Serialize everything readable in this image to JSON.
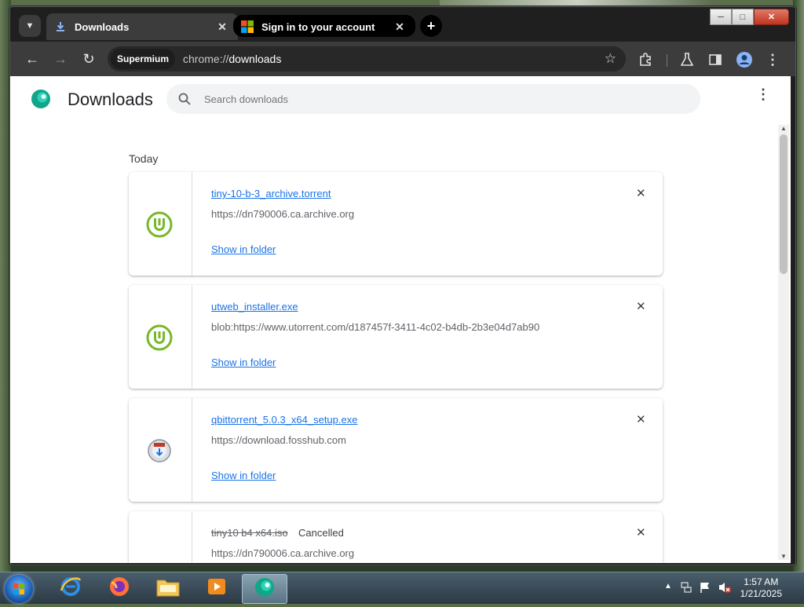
{
  "browser": {
    "tabs": [
      {
        "title": "Downloads",
        "active": true,
        "icon": "download-icon"
      },
      {
        "title": "Sign in to your account",
        "active": false,
        "icon": "microsoft-icon"
      }
    ],
    "new_tab_label": "+",
    "close_glyph": "✕",
    "profile_chip": "Supermium",
    "url_scheme": "chrome://",
    "url_host": "downloads"
  },
  "page": {
    "title": "Downloads",
    "search_placeholder": "Search downloads",
    "section_label": "Today",
    "show_in_folder": "Show in folder",
    "downloads": [
      {
        "name": "tiny-10-b-3_archive.torrent",
        "source": "https://dn790006.ca.archive.org",
        "status": "",
        "icon": "utorrent-icon"
      },
      {
        "name": "utweb_installer.exe",
        "source": "blob:https://www.utorrent.com/d187457f-3411-4c02-b4db-2b3e04d7ab90",
        "status": "",
        "icon": "utorrent-icon"
      },
      {
        "name": "qbittorrent_5.0.3_x64_setup.exe",
        "source": "https://download.fosshub.com",
        "status": "",
        "icon": "installer-icon"
      },
      {
        "name": "tiny10 b4 x64.iso",
        "source": "https://dn790006.ca.archive.org",
        "status": "Cancelled",
        "icon": "file-icon"
      }
    ]
  },
  "taskbar": {
    "time": "1:57 AM",
    "date": "1/21/2025"
  }
}
